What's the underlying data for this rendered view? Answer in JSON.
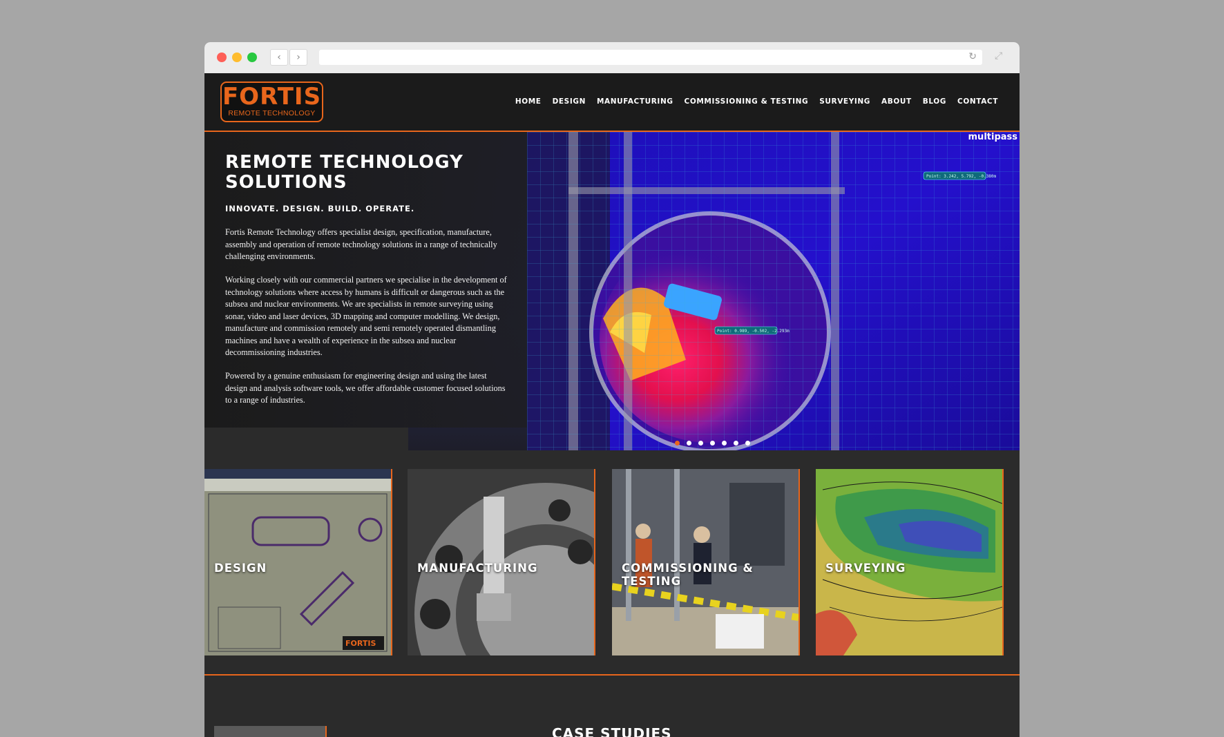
{
  "browser": {
    "back_icon": "‹",
    "forward_icon": "›",
    "reload_icon": "↻",
    "expand_icon": "⤢"
  },
  "site": {
    "logo": {
      "name": "FORTIS",
      "tagline": "REMOTE TECHNOLOGY"
    },
    "nav": [
      "HOME",
      "DESIGN",
      "MANUFACTURING",
      "COMMISSIONING & TESTING",
      "SURVEYING",
      "ABOUT",
      "BLOG",
      "CONTACT"
    ]
  },
  "hero": {
    "title": "REMOTE TECHNOLOGY SOLUTIONS",
    "subtitle": "INNOVATE. DESIGN. BUILD. OPERATE.",
    "paragraphs": [
      "Fortis Remote Technology offers specialist design, specification, manufacture, assembly and operation of remote technology solutions in a range of technically challenging environments.",
      "Working closely with our commercial partners we specialise in the development of technology solutions where access by humans is difficult or dangerous such as the subsea and nuclear environments. We are specialists in remote surveying using sonar, video and laser devices, 3D mapping and computer modelling. We design, manufacture and commission remotely and semi remotely operated dismantling machines and have a wealth of experience in the subsea and nuclear decommissioning industries.",
      "Powered by a genuine enthusiasm for engineering design and using the latest design and analysis software tools, we offer affordable customer focused solutions to a range of industries."
    ],
    "image_brand": "multipass",
    "image_labels": [
      "Point: 3.242, 5.792, -0.380m",
      "Point: 0.989, -0.502, -2.293m"
    ],
    "slide_count": 7,
    "active_slide": 0,
    "colors": {
      "accent": "#e8661c"
    }
  },
  "tiles": [
    {
      "label": "DESIGN"
    },
    {
      "label": "MANUFACTURING"
    },
    {
      "label": "COMMISSIONING & TESTING"
    },
    {
      "label": "SURVEYING"
    }
  ],
  "case_studies": {
    "title": "CASE STUDIES"
  }
}
